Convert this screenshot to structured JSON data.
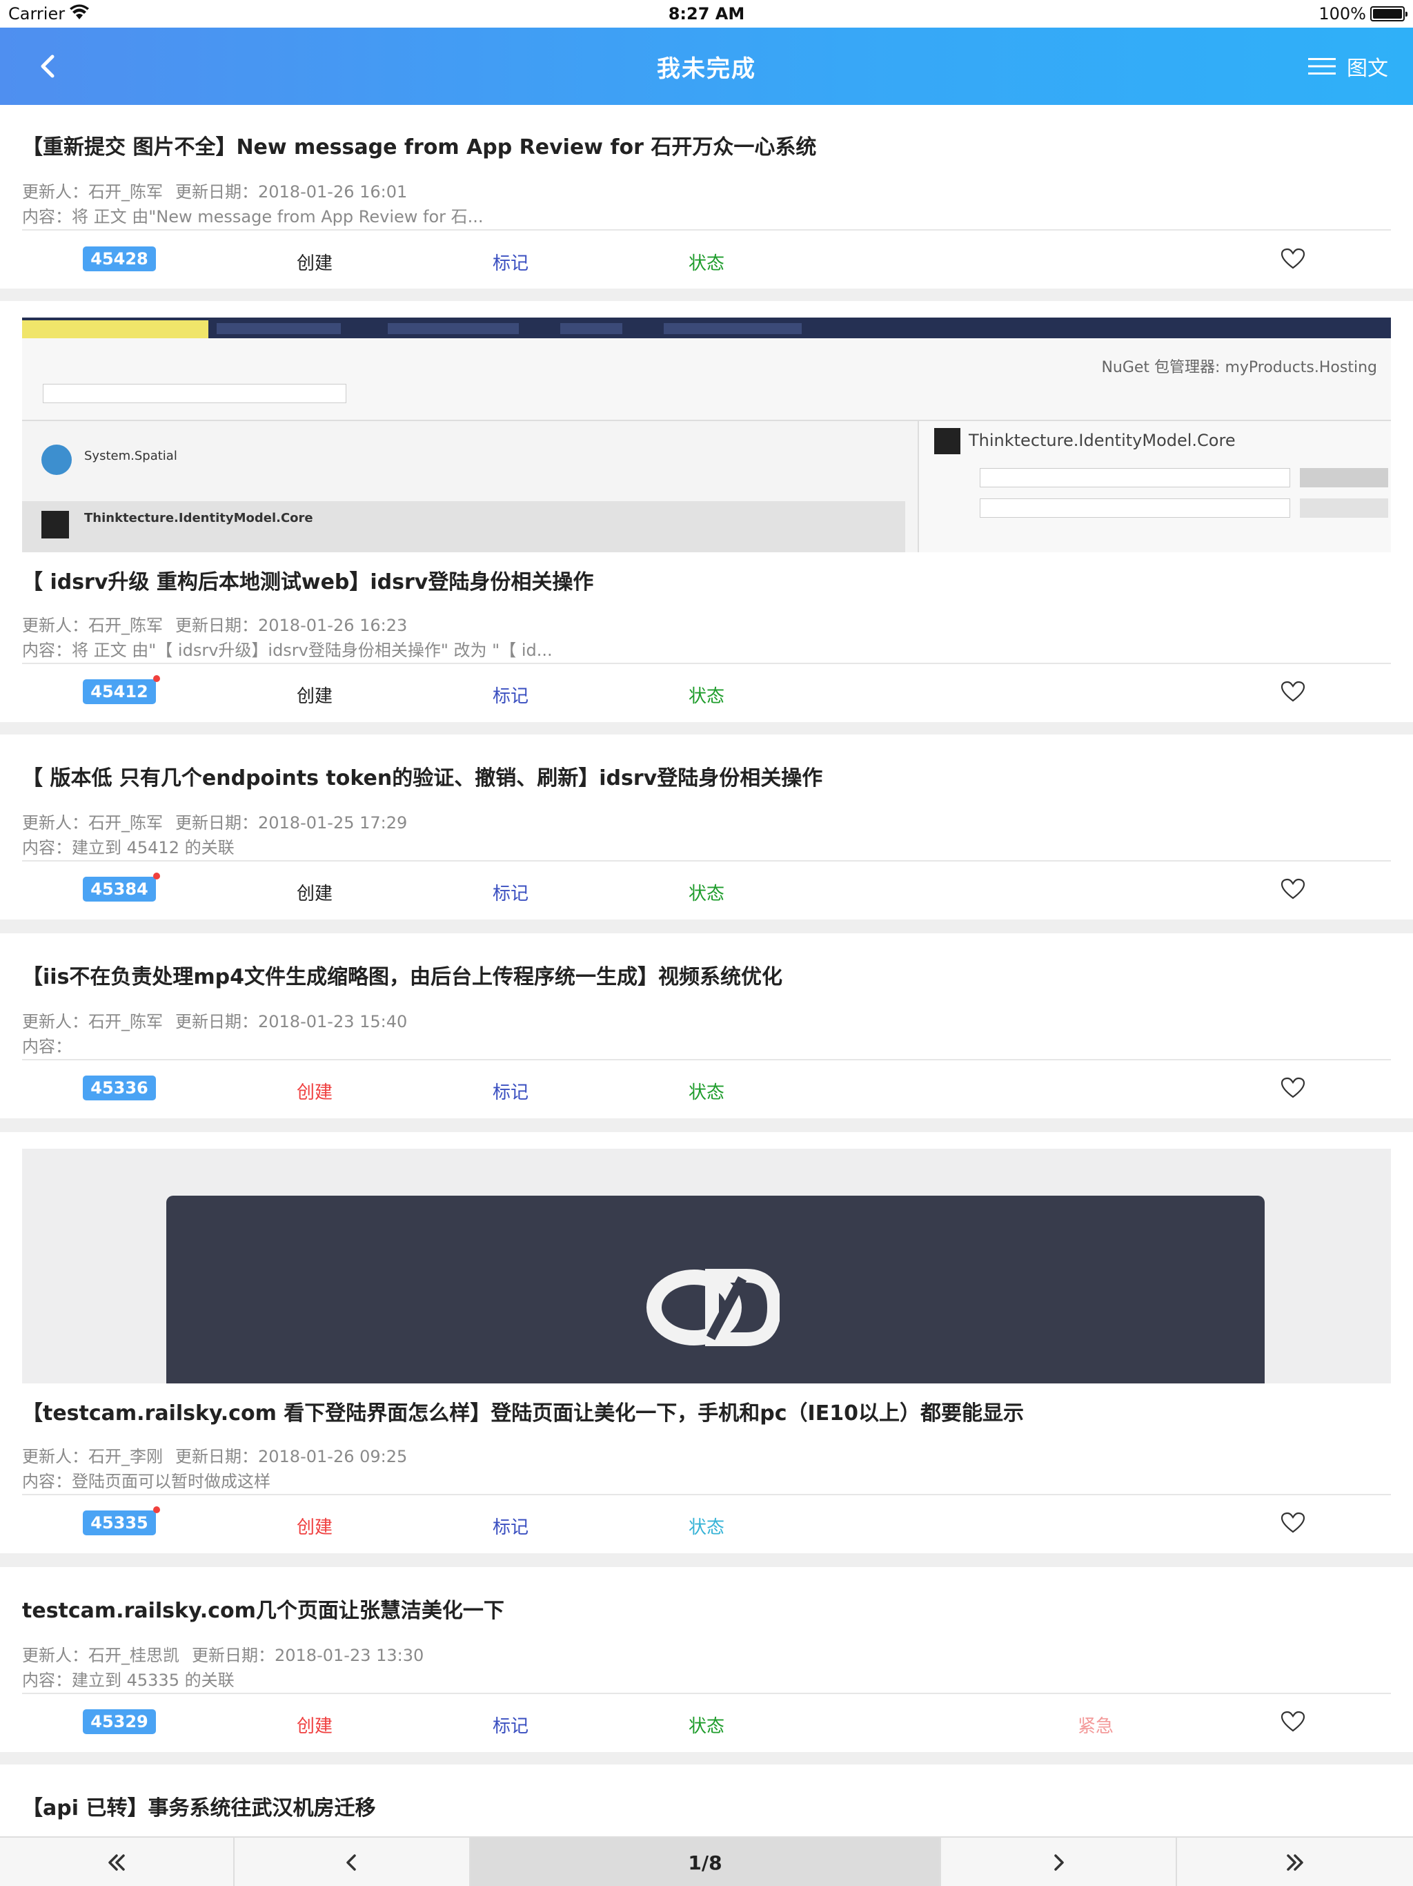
{
  "status_bar": {
    "carrier": "Carrier",
    "time": "8:27 AM",
    "battery": "100%"
  },
  "nav": {
    "title": "我未完成",
    "mode_label": "图文"
  },
  "labels": {
    "updater": "更新人：",
    "updated_date": "更新日期：",
    "content": "内容：",
    "create": "创建",
    "mark": "标记",
    "state": "状态",
    "urgent": "紧急"
  },
  "items": [
    {
      "title": "【重新提交 图片不全】New message from App Review for 石开万众一心系统",
      "updater": "石开_陈军",
      "date": "2018-01-26 16:01",
      "content": "将 正文 由\"New message from App Review for 石...",
      "id": "45428",
      "unread": false
    },
    {
      "title": "【 idsrv升级 重构后本地测试web】idsrv登陆身份相关操作",
      "updater": "石开_陈军",
      "date": "2018-01-26 16:23",
      "content": "将 正文 由\"【 idsrv升级】idsrv登陆身份相关操作\" 改为 \"【 id...",
      "id": "45412",
      "unread": true,
      "image": {
        "manager_title": "NuGet 包管理器: myProducts.Hosting",
        "package_1": "System.Spatial",
        "package_2": "Thinktecture.IdentityModel.Core",
        "detail_title": "Thinktecture.IdentityModel.Core"
      }
    },
    {
      "title": "【 版本低 只有几个endpoints token的验证、撤销、刷新】idsrv登陆身份相关操作",
      "updater": "石开_陈军",
      "date": "2018-01-25 17:29",
      "content": "建立到 45412 的关联",
      "id": "45384",
      "unread": true
    },
    {
      "title": "【iis不在负责处理mp4文件生成缩略图，由后台上传程序统一生成】视频系统优化",
      "updater": "石开_陈军",
      "date": "2018-01-23 15:40",
      "content": "",
      "id": "45336",
      "unread": false
    },
    {
      "title": "【testcam.railsky.com 看下登陆界面怎么样】登陆页面让美化一下，手机和pc（IE10以上）都要能显示",
      "updater": "石开_李刚",
      "date": "2018-01-26 09:25",
      "content": "登陆页面可以暂时做成这样",
      "id": "45335",
      "unread": true
    },
    {
      "title": "testcam.railsky.com几个页面让张慧洁美化一下",
      "updater": "石开_桂思凯",
      "date": "2018-01-23 13:30",
      "content": "建立到 45335 的关联",
      "id": "45329",
      "unread": false
    },
    {
      "title": "【api 已转】事务系统往武汉机房迁移"
    }
  ],
  "pager": {
    "page": "1/8"
  },
  "colors": {
    "nav_start": "#4f8ff0",
    "nav_end": "#2fb0f8",
    "badge": "#4aa3f4",
    "create_red": "#ef4040",
    "mark_blue": "#3a4fc0",
    "state_green": "#1e9c2b",
    "state_cyan": "#36b3d6",
    "urgent_pink": "#f39a9a"
  },
  "icons": [
    "back-chevron-icon",
    "menu-icon",
    "heart-icon",
    "first-page-icon",
    "prev-page-icon",
    "next-page-icon",
    "last-page-icon",
    "wifi-icon",
    "battery-icon"
  ]
}
